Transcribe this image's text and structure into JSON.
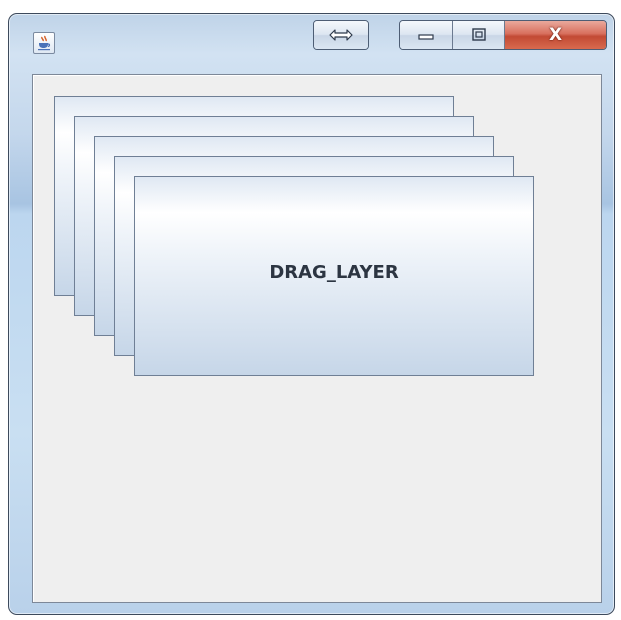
{
  "window": {
    "title": "",
    "drag_icon": "double-arrow-icon",
    "minimize_icon": "minimize-icon",
    "maximize_icon": "maximize-icon",
    "close_label": "X"
  },
  "layers": [
    {
      "label": ""
    },
    {
      "label": ""
    },
    {
      "label": ""
    },
    {
      "label": ""
    },
    {
      "label": "DRAG_LAYER"
    }
  ],
  "colors": {
    "close_button": "#c24a34",
    "content_background": "#efefef",
    "card_border": "#6f7f95"
  }
}
